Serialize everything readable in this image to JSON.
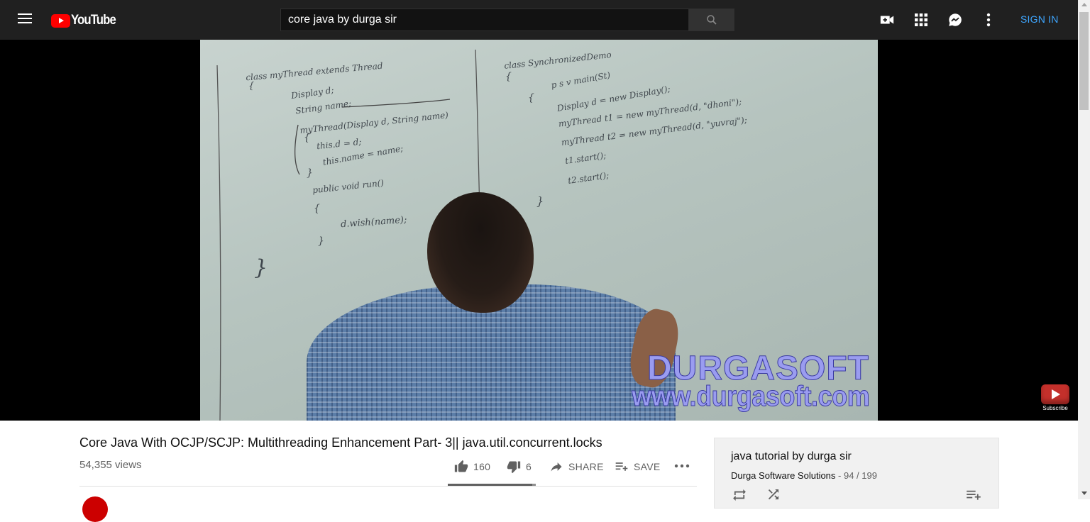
{
  "header": {
    "logo_text": "YouTube",
    "search_value": "core java by durga sir",
    "sign_in_label": "SIGN IN"
  },
  "icons": {
    "menu": "hamburger-menu-icon",
    "search": "search-icon",
    "create": "video-camera-icon",
    "apps": "apps-grid-icon",
    "messages": "chat-bubble-icon",
    "settings": "more-vertical-icon"
  },
  "video": {
    "watermark_line1": "DURGASOFT",
    "watermark_line2": "www.durgasoft.com",
    "subscribe_badge": "Subscribe",
    "board_left": [
      "class myThread extends Thread",
      "{",
      "Display d;",
      "String name;",
      "myThread(Display d, String name)",
      "{",
      "this.d = d;",
      "this.name = name;",
      "}",
      "public void run()",
      "{",
      "d.wish(name);",
      "}",
      "}"
    ],
    "board_right": [
      "class SynchronizedDemo",
      "{",
      "p s v main(St)",
      "{",
      "Display d = new Display();",
      "myThread t1 = new myThread(d, \"dhoni\");",
      "myThread t2 = new myThread(d, \"yuvraj\");",
      "t1.start();",
      "t2.start();",
      "}"
    ]
  },
  "info": {
    "title": "Core Java With OCJP/SCJP: Multithreading Enhancement Part- 3|| java.util.concurrent.locks",
    "views": "54,355 views",
    "likes": "160",
    "dislikes": "6",
    "share_label": "SHARE",
    "save_label": "SAVE",
    "like_ratio": 0.96
  },
  "playlist": {
    "title": "java tutorial by durga sir",
    "channel": "Durga Software Solutions",
    "position": "- 94 / 199"
  },
  "colors": {
    "masthead": "#202020",
    "accent_blue": "#3ea6ff",
    "logo_red": "#ff0000"
  }
}
